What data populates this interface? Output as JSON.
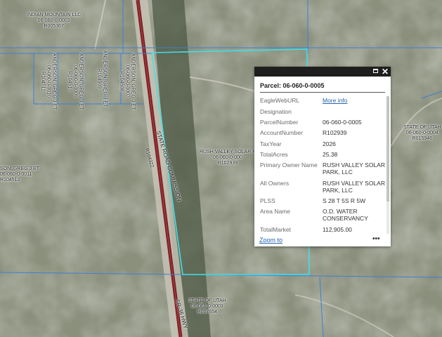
{
  "map": {
    "parcel_labels": {
      "indian_mountain": [
        "INDIAN MOUNTAIN LLC",
        "06-060-0-0002",
        "R005367"
      ],
      "anderson_1": [
        "ANDERSON, GREG J ET",
        "06-060-0-0010",
        "R104511"
      ],
      "anderson_2": [
        "ANDERSON, GREG J ET",
        "06-060-0-0009",
        "R104510"
      ],
      "anderson_3": [
        "ANDERSON, GREG J ET",
        "R104509"
      ],
      "anderson_4": [
        "ANDERSON, GREG J ET",
        "06-060-0-0007",
        "R104508"
      ],
      "anderson_left": [
        "SON, GREG J ET",
        "06-060-0-0011",
        "R104512"
      ],
      "rush_valley": [
        "RUSH VALLEY SOLAR P",
        "06-060-0-000",
        "R102939"
      ],
      "state_right": [
        "STATE OF UTAH",
        "06-060-0-0004",
        "R015946"
      ],
      "state_bottom": [
        "STATE OF UTAH",
        "06-061-0-0003",
        "R007654"
      ]
    },
    "road_labels": {
      "state_road": "STATE ROAD COMMISSION",
      "state_road_id": "R104322",
      "sr36": "SR-36 HWY"
    }
  },
  "popup": {
    "title": "Parcel: 06-060-0-0005",
    "rows": [
      {
        "key": "EagleWebURL",
        "value": "More info",
        "link": true
      },
      {
        "key": "Designation",
        "value": ""
      },
      {
        "key": "ParcelNumber",
        "value": "06-060-0-0005"
      },
      {
        "key": "AccountNumber",
        "value": "R102939"
      },
      {
        "key": "TaxYear",
        "value": "2026"
      },
      {
        "key": "TotalAcres",
        "value": "25.38"
      },
      {
        "key": "Primary Owner Name",
        "value": "RUSH VALLEY SOLAR PARK, LLC"
      },
      {
        "key": "All Owners",
        "value": "RUSH VALLEY SOLAR PARK, LLC"
      },
      {
        "key": "PLSS",
        "value": "S 28 T 5S R 5W"
      },
      {
        "key": "Area Name",
        "value": "O.D. WATER CONSERVANCY"
      },
      {
        "key": "TotalMarket",
        "value": "112,905.00"
      }
    ],
    "zoom_label": "Zoom to",
    "more_label": "•••",
    "maximize_icon": "maximize-icon",
    "close_icon": "close-icon",
    "close_glyph": "✕"
  },
  "colors": {
    "selected_parcel": "#3fe0e8",
    "parcel_lines": "#3d7fd6",
    "road": "#7a1f24",
    "terrain_base": "#8b8f7a"
  }
}
